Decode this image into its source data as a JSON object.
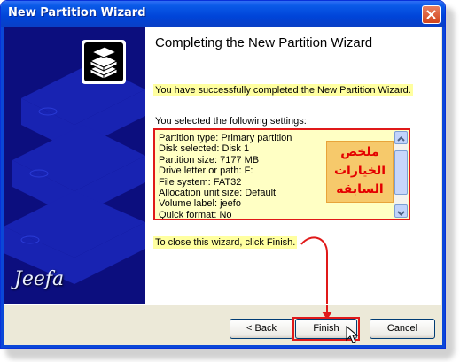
{
  "window": {
    "title": "New Partition Wizard"
  },
  "side": {
    "watermark": "Jeefa"
  },
  "main": {
    "heading": "Completing the New Partition Wizard",
    "success_text": "You have successfully completed the New Partition Wizard.",
    "settings_label": "You selected the following settings:",
    "settings": [
      "Partition type: Primary partition",
      "Disk selected: Disk 1",
      "Partition size: 7177 MB",
      "Drive letter or path: F:",
      "File system: FAT32",
      "Allocation unit size: Default",
      "Volume label: jeefo",
      "Quick format: No"
    ],
    "annotation_lines": [
      "ملخص",
      "الخيارات",
      "السابقه"
    ],
    "close_text": "To close this wizard, click Finish."
  },
  "buttons": {
    "back": "< Back",
    "finish": "Finish",
    "cancel": "Cancel"
  },
  "colors": {
    "titlebar": "#0A5AE8",
    "highlight": "#FFFFA0",
    "annotation_red": "#E01919",
    "side_panel": "#0C0E7E"
  }
}
